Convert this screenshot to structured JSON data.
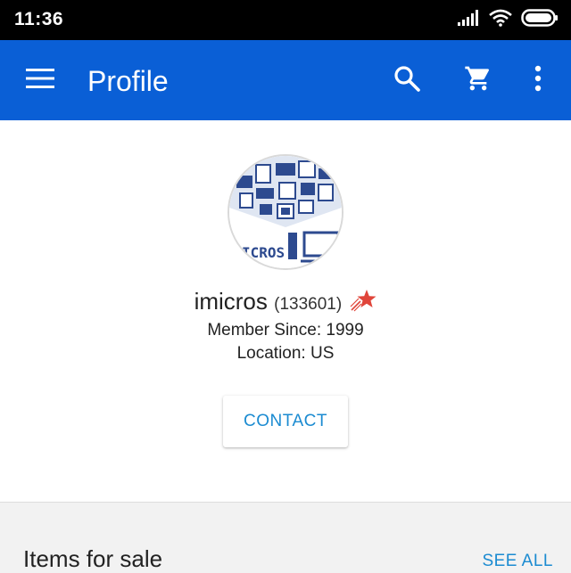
{
  "status_bar": {
    "time": "11:36"
  },
  "app_bar": {
    "title": "Profile"
  },
  "profile": {
    "username": "imicros",
    "user_id": "(133601)",
    "member_since": "Member Since: 1999",
    "location": "Location: US",
    "avatar_text": "ICROS",
    "contact_label": "CONTACT"
  },
  "items_section": {
    "title": "Items for sale",
    "see_all_label": "SEE ALL"
  },
  "colors": {
    "app_bar": "#0a5fd6",
    "accent": "#1b8bd1",
    "star": "#e0453a"
  },
  "icons": [
    "menu-icon",
    "search-icon",
    "cart-icon",
    "more-vert-icon",
    "signal-icon",
    "wifi-icon",
    "battery-icon",
    "shooting-star-icon"
  ]
}
